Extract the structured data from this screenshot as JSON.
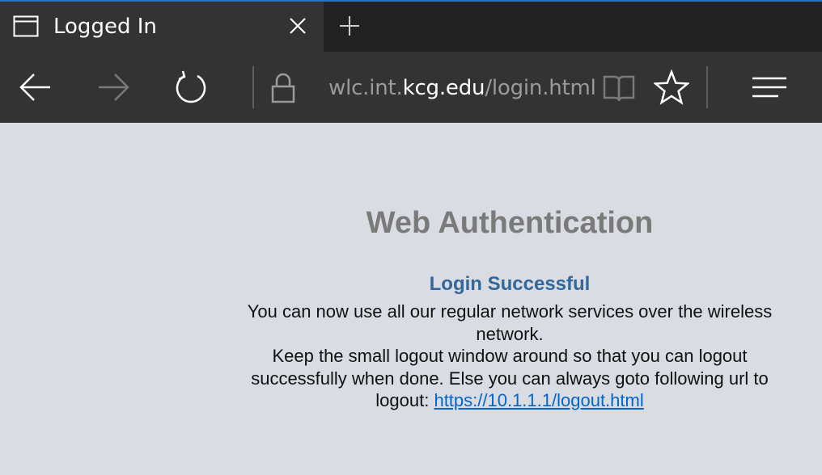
{
  "browser": {
    "tab": {
      "title": "Logged In",
      "icon": "window-icon"
    },
    "new_tab_icon": "plus-icon",
    "close_icon": "close-icon",
    "address": {
      "prefix": "wlc.int.",
      "domain": "kcg.edu",
      "suffix": "/login.html"
    },
    "nav_icons": [
      "back-arrow-icon",
      "forward-arrow-icon",
      "refresh-icon",
      "lock-icon",
      "reading-view-icon",
      "star-icon",
      "hub-menu-icon"
    ],
    "colors": {
      "accent": "#2a6fd6",
      "toolbar": "#333333",
      "tabstrip": "#222222"
    }
  },
  "page": {
    "title": "Web Authentication",
    "status": "Login Successful",
    "message_line1": "You can now use all our regular network services over the wireless network.",
    "message_line2": "Keep the small logout window around so that you can logout successfully when done. Else you can always goto following url to logout:",
    "logout_link": "https://10.1.1.1/logout.html",
    "colors": {
      "background": "#d9dce3",
      "title": "#7a7a7a",
      "status": "#336699",
      "link": "#0066cc"
    }
  }
}
